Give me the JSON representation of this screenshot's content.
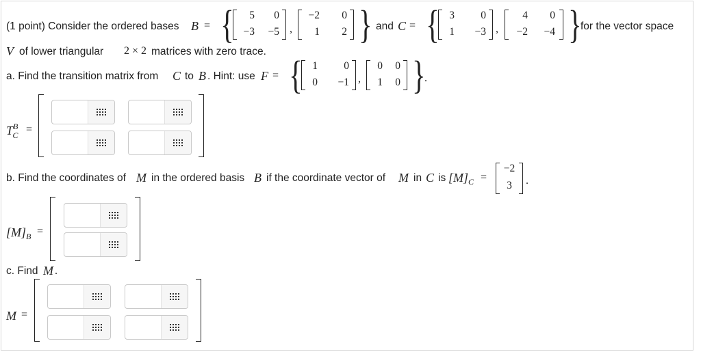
{
  "problem": {
    "intro": "(1 point) Consider the ordered bases",
    "basis_b": "B",
    "eq": "=",
    "and": "and",
    "basis_c": "C",
    "for_space": "for the vector space",
    "space_v": "V",
    "space_desc": "of lower triangular",
    "dims": "2 × 2",
    "zero_trace": "matrices with zero trace.",
    "comma": ",",
    "period": ".",
    "B_matrices": [
      [
        [
          "5",
          "0"
        ],
        [
          "−3",
          "−5"
        ]
      ],
      [
        [
          "−2",
          "0"
        ],
        [
          "1",
          "2"
        ]
      ]
    ],
    "C_matrices": [
      [
        [
          "3",
          "0"
        ],
        [
          "1",
          "−3"
        ]
      ],
      [
        [
          "4",
          "0"
        ],
        [
          "−2",
          "−4"
        ]
      ]
    ]
  },
  "part_a": {
    "label": "a. Find the transition matrix from",
    "c": "C",
    "to": "to",
    "b": "B",
    "hint": ". Hint: use",
    "f": "F",
    "F_matrices": [
      [
        [
          "1",
          "0"
        ],
        [
          "0",
          "−1"
        ]
      ],
      [
        [
          "0",
          "0"
        ],
        [
          "1",
          "0"
        ]
      ]
    ],
    "answer_label_T": "T",
    "answer_label_sup": "B",
    "answer_label_sub": "C"
  },
  "part_b": {
    "label": "b. Find the coordinates of",
    "m": "M",
    "in_basis": "in the ordered basis",
    "b": "B",
    "if_text": "if the coordinate vector of",
    "in_text": "in",
    "c": "C",
    "is": "is",
    "given_vector": [
      "−2",
      "3"
    ],
    "answer_label": "[M]",
    "answer_label_sub": "B"
  },
  "part_c": {
    "label": "c. Find",
    "m": "M",
    "answer_label": "M"
  },
  "answers": {
    "part_a": [
      "",
      "",
      "",
      ""
    ],
    "part_b": [
      "",
      ""
    ],
    "part_c": [
      "",
      "",
      "",
      ""
    ]
  },
  "icons": {
    "keyboard": "matrix-keyboard-icon"
  },
  "colors": {
    "text": "#222222",
    "input_border": "#c9c9c9"
  }
}
